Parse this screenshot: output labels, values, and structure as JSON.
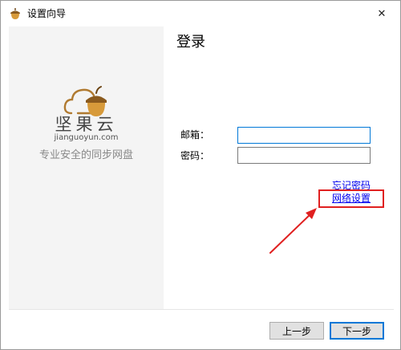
{
  "window": {
    "title": "设置向导",
    "close_symbol": "✕"
  },
  "sidebar": {
    "brand_name": "坚果云",
    "brand_domain": "jianguoyun.com",
    "slogan": "专业安全的同步网盘"
  },
  "main": {
    "title": "登录",
    "email_label": "邮箱：",
    "email_value": "",
    "password_label": "密码：",
    "password_value": "",
    "forgot_password_link": "忘记密码",
    "network_settings_link": "网络设置"
  },
  "footer": {
    "prev_label": "上一步",
    "next_label": "下一步"
  },
  "colors": {
    "accent": "#0078d7",
    "annotation": "#e02020",
    "link": "#0000ee"
  },
  "icons": {
    "app": "acorn-icon",
    "close": "close-icon",
    "logo": "acorn-cloud-logo-icon"
  }
}
